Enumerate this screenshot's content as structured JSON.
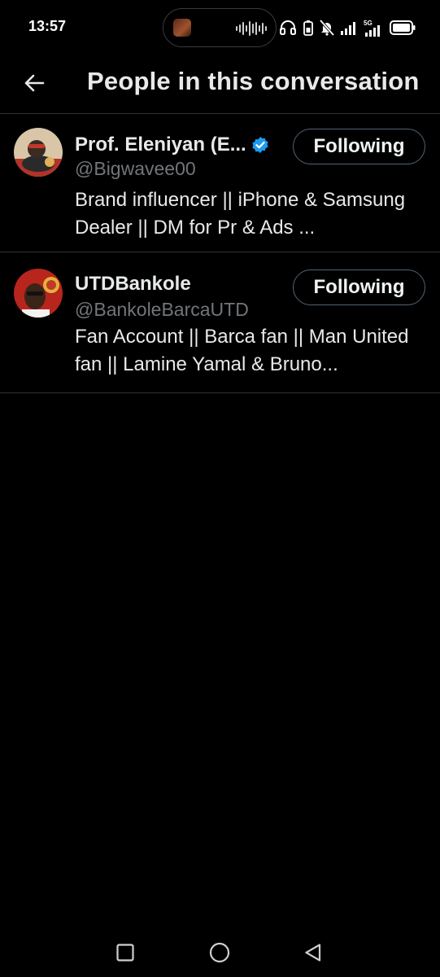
{
  "status_bar": {
    "time": "13:57",
    "network": "5G",
    "icons": [
      "headphones-icon",
      "battery-saver-icon",
      "bell-off-icon",
      "signal-icon",
      "battery-icon"
    ]
  },
  "header": {
    "back_icon": "arrow-left-icon",
    "title": "People in this conversation"
  },
  "users": [
    {
      "display_name": "Prof. Eleniyan (E...",
      "verified": true,
      "handle": "@Bigwavee00",
      "bio": "Brand influencer || iPhone & Samsung Dealer || DM for Pr & Ads ...",
      "follow_label": "Following"
    },
    {
      "display_name": "UTDBankole",
      "verified": false,
      "handle": "@BankoleBarcaUTD",
      "bio": "Fan Account || Barca fan || Man United fan || Lamine Yamal & Bruno...",
      "follow_label": "Following"
    }
  ],
  "nav_bar": {
    "buttons": [
      "recents-square-icon",
      "home-circle-icon",
      "back-triangle-icon"
    ]
  },
  "colors": {
    "background": "#000000",
    "text_primary": "#e7e9ea",
    "text_secondary": "#71767b",
    "divider": "#2f3336",
    "verified_blue": "#1d9bf0",
    "button_border": "#536471"
  }
}
